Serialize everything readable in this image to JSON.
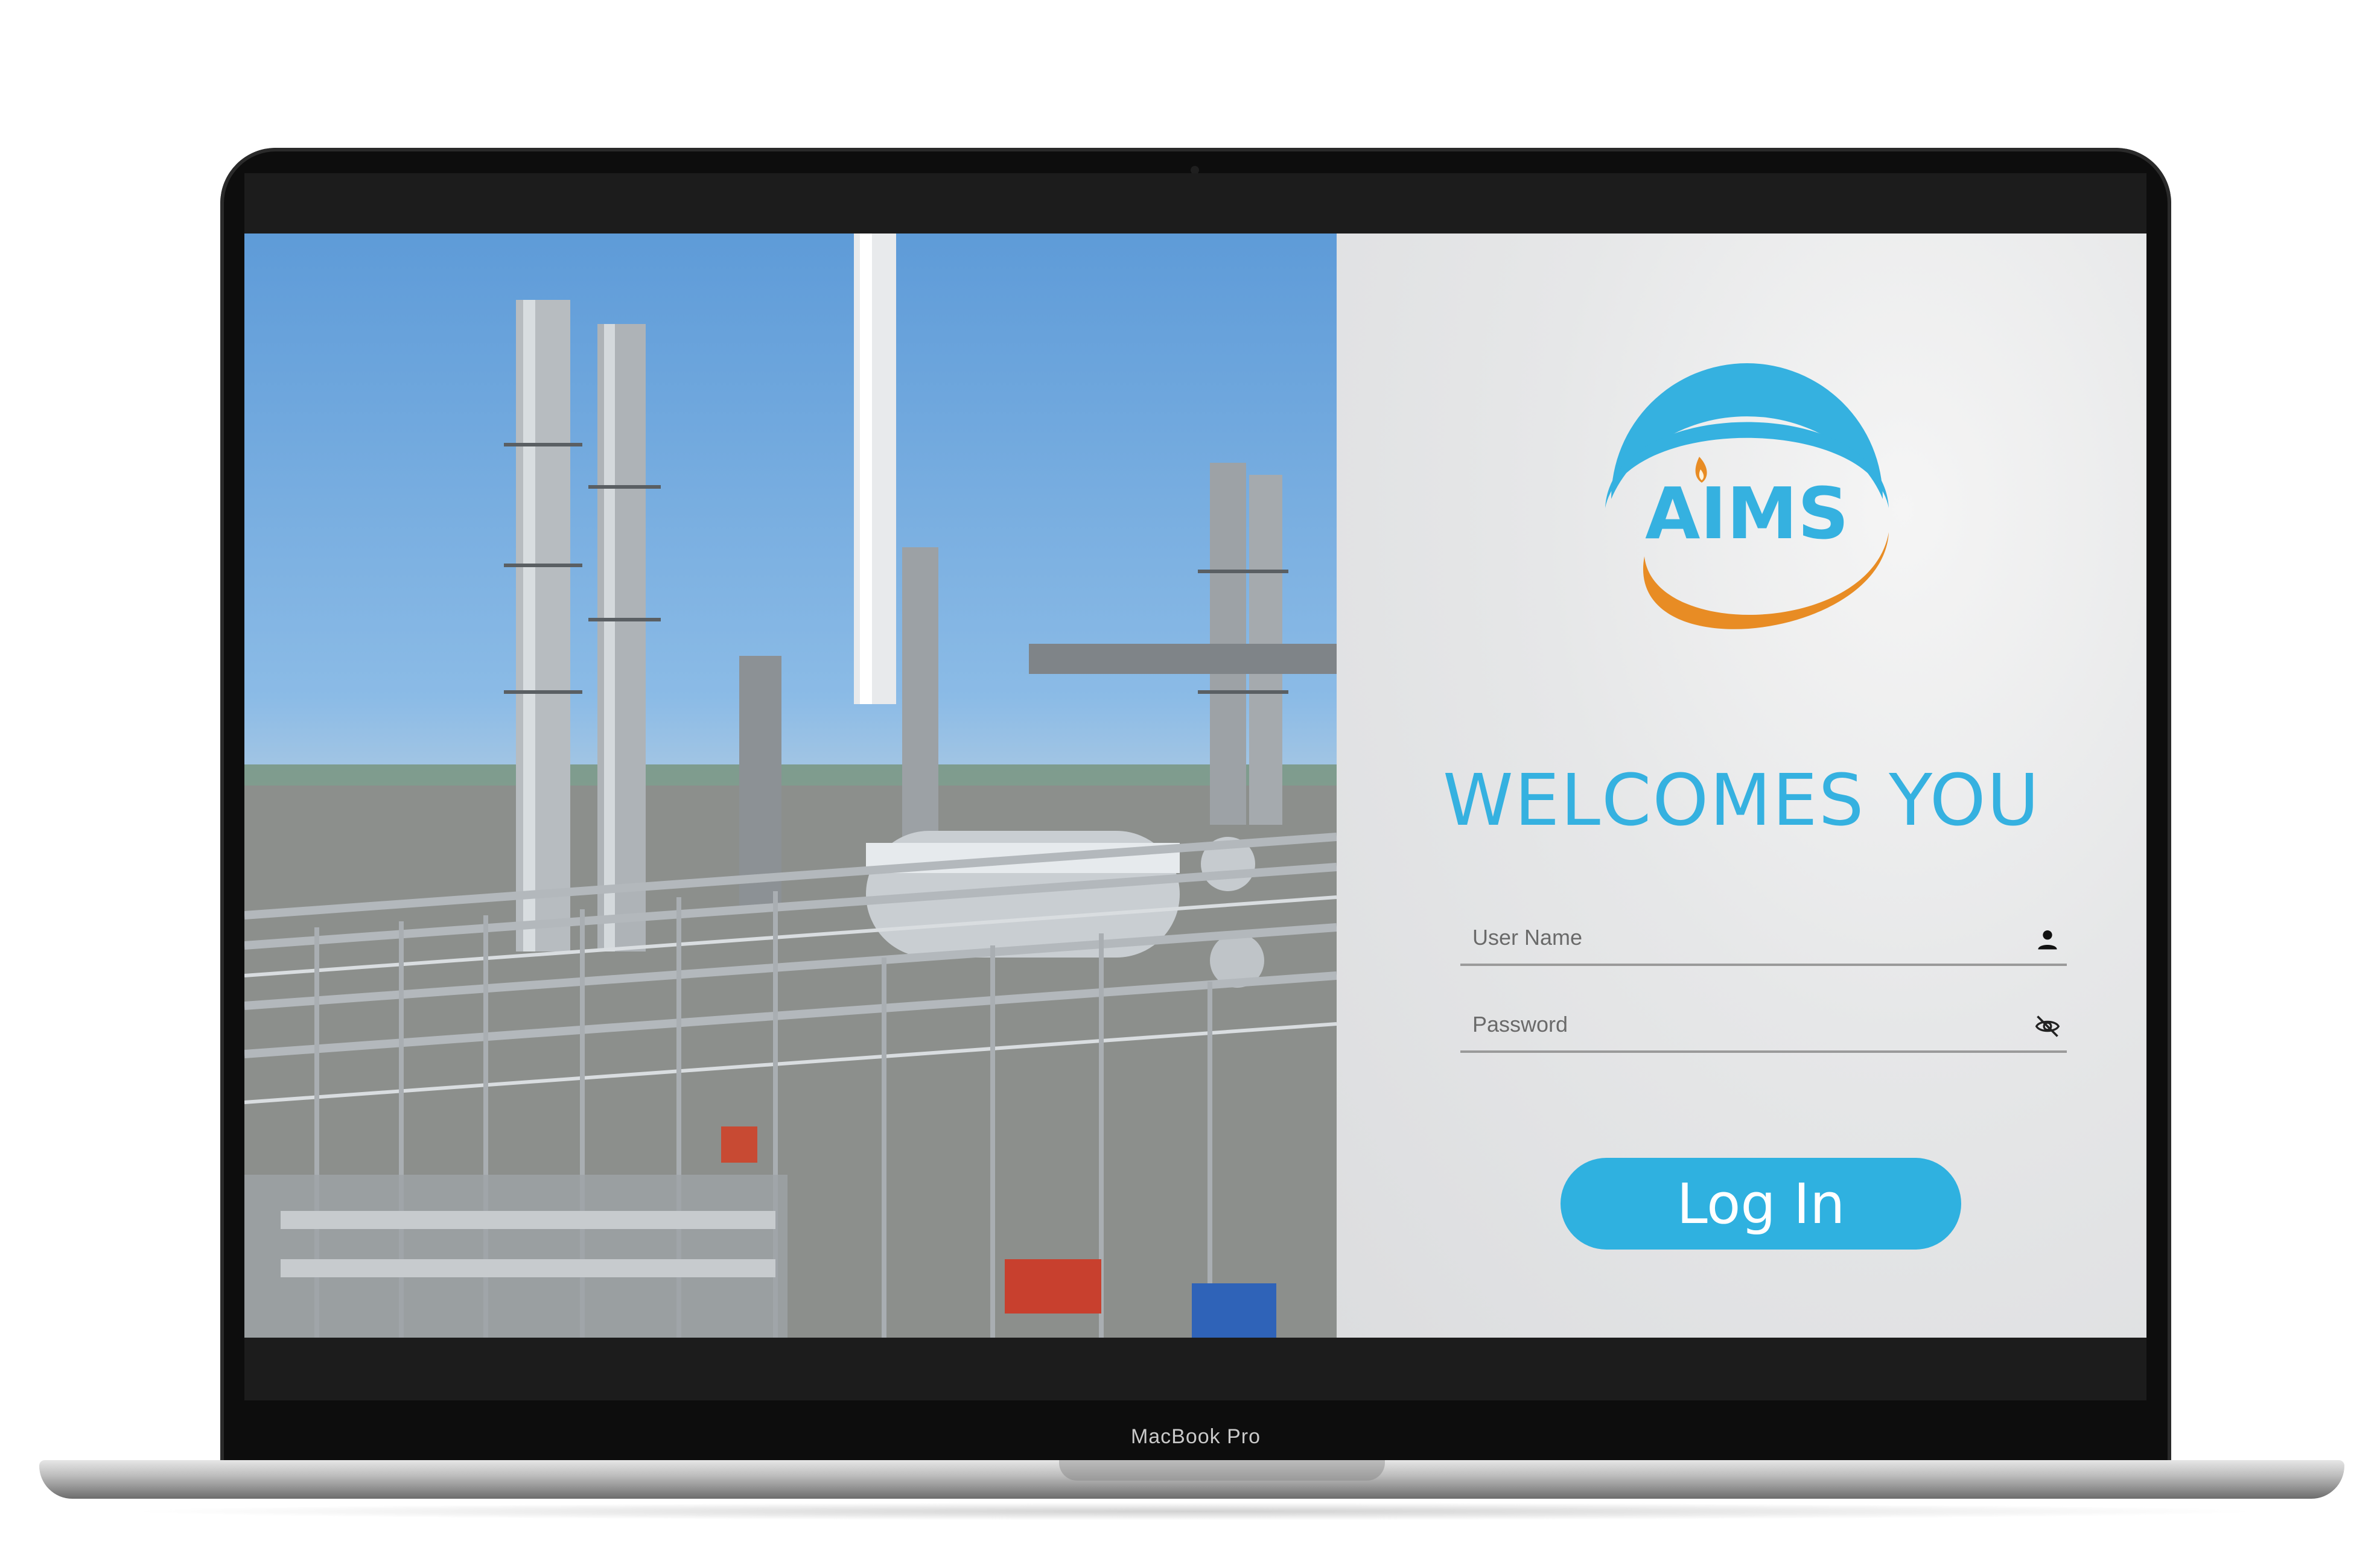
{
  "device": {
    "model_label": "MacBook Pro"
  },
  "brand": {
    "logo_text": "AIMS",
    "accent_color": "#35b1e0",
    "secondary_color": "#e88c24"
  },
  "login": {
    "heading": "WELCOMES YOU",
    "username": {
      "placeholder": "User Name",
      "value": "",
      "icon": "user-icon"
    },
    "password": {
      "placeholder": "Password",
      "value": "",
      "icon": "eye-off-icon"
    },
    "submit_label": "Log In"
  },
  "hero": {
    "image": "industrial-gas-processing-plant-photo"
  }
}
